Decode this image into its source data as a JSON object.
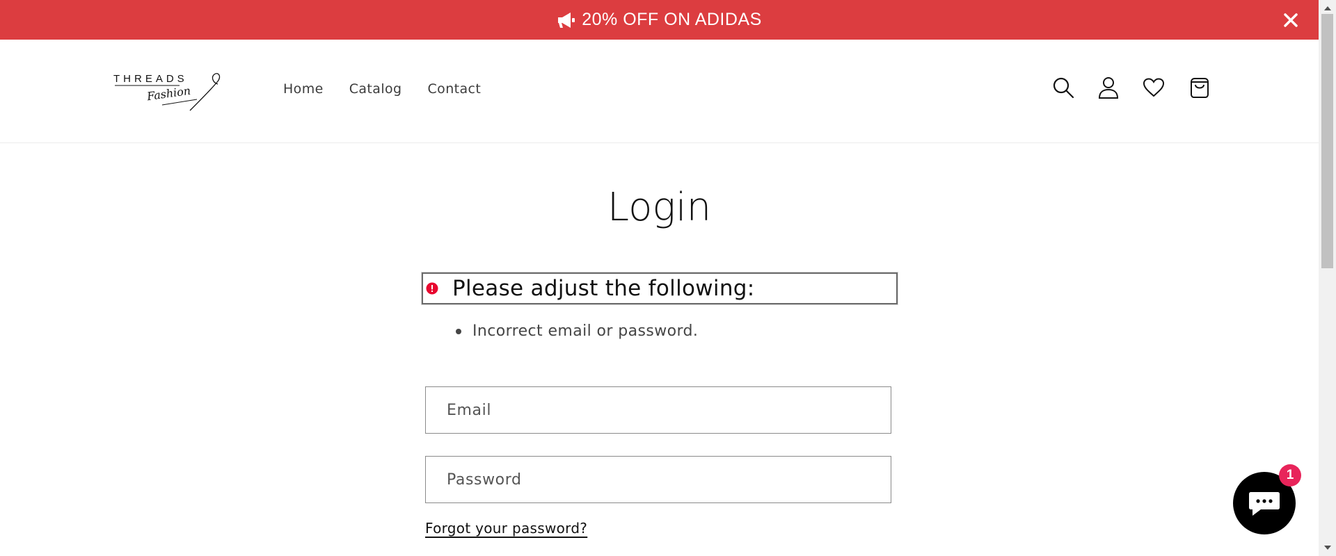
{
  "announcement": {
    "text": "20% OFF ON ADIDAS",
    "icon": "megaphone-icon",
    "color": "#dc3d40"
  },
  "header": {
    "logo": {
      "line1": "THREADS",
      "line2": "Fashion"
    },
    "nav": [
      {
        "label": "Home"
      },
      {
        "label": "Catalog"
      },
      {
        "label": "Contact"
      }
    ],
    "icons": [
      "search-icon",
      "account-icon",
      "heart-icon",
      "cart-icon"
    ]
  },
  "main": {
    "title": "Login",
    "error": {
      "heading": "Please adjust the following:",
      "items": [
        "Incorrect email or password."
      ],
      "icon_color": "#e8062f"
    },
    "email": {
      "placeholder": "Email",
      "value": ""
    },
    "password": {
      "placeholder": "Password",
      "value": ""
    },
    "forgot_link": "Forgot your password?"
  },
  "chat": {
    "badge_count": "1",
    "badge_color": "#e8245a"
  }
}
